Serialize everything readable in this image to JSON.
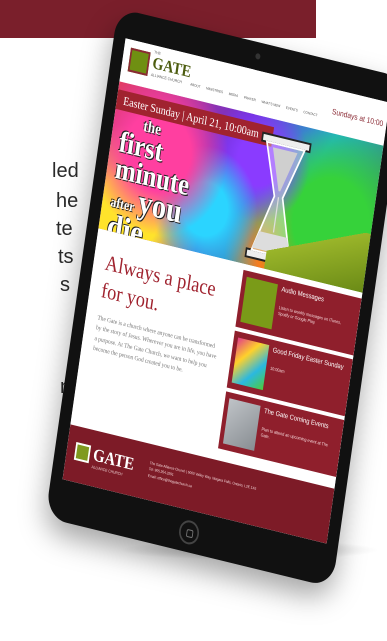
{
  "background_text": {
    "lines": [
      "led",
      "he",
      "te",
      "ts",
      "s",
      "n"
    ]
  },
  "site": {
    "logo_the": "THE",
    "logo": "GATE",
    "logo_sub": "ALLIANCE CHURCH",
    "nav": [
      "ABOUT",
      "MINISTRIES",
      "MEDIA",
      "PRAYER",
      "WHAT'S NEW",
      "EVENTS",
      "CONTACT"
    ],
    "service_time": "Sundays at 10:00"
  },
  "hero": {
    "bar": "Easter Sunday | April 21, 10:00am",
    "line1": "the",
    "line2": "first",
    "line3": "minute",
    "line4": "after",
    "line5": "you",
    "line6": "die..."
  },
  "content": {
    "tagline": "Always a place for you.",
    "about": "The Gate is a church where anyone can be transformed by the story of Jesus. Wherever you are in life, you have a purpose. At The Gate Church, we want to help you become the person God created you to be."
  },
  "cards": [
    {
      "title": "Audio Messages",
      "desc": "Listen to weekly messages on iTunes, Spotify or Google Play.",
      "color": "#7a9b18"
    },
    {
      "title": "Good Friday Easter Sunday",
      "desc": "10:00am",
      "color": "#e13b8a"
    },
    {
      "title": "The Gate Coming Events",
      "desc": "Plan to attend an upcoming event at The Gate.",
      "color": "#9aa0a6"
    }
  ],
  "footer": {
    "logo": "GATE",
    "sub": "ALLIANCE CHURCH",
    "address": "The Gate Alliance Church | 6000 Valley Way, Niagara Falls, Ontario, L2E 1X6",
    "phone": "Tel: 905.354.3291",
    "email": "Email: office@thegatechurch.ca"
  },
  "colors": {
    "brand_maroon": "#7a1f2b",
    "brand_green": "#6f8f12"
  }
}
